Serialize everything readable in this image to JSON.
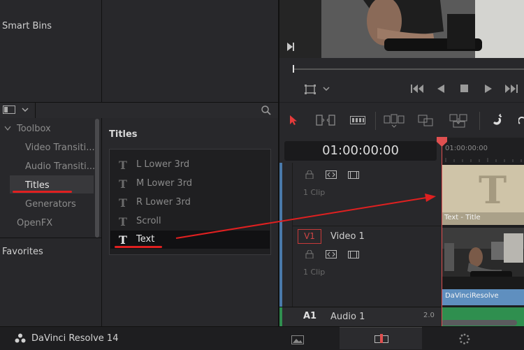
{
  "media_pool": {
    "smart_bins": "Smart Bins"
  },
  "effects_library": {
    "toolbox": "Toolbox",
    "items": [
      {
        "label": "Video Transiti..."
      },
      {
        "label": "Audio Transiti..."
      },
      {
        "label": "Titles"
      },
      {
        "label": "Generators"
      }
    ],
    "openfx": "OpenFX",
    "favorites": "Favorites"
  },
  "titles_panel": {
    "heading": "Titles",
    "items": [
      {
        "label": "L Lower 3rd"
      },
      {
        "label": "M Lower 3rd"
      },
      {
        "label": "R Lower 3rd"
      },
      {
        "label": "Scroll"
      },
      {
        "label": "Text"
      }
    ]
  },
  "timeline": {
    "timecode": "01:00:00:00",
    "ruler_label": "01:00:00:00",
    "tracks": {
      "upper_clip_count": "1 Clip",
      "v1_badge": "V1",
      "v1_name": "Video 1",
      "v1_clip_count": "1 Clip",
      "a1_badge": "A1",
      "a1_name": "Audio 1",
      "a1_level": "2.0"
    },
    "clips": {
      "title_clip": "Text - Title",
      "title_glyph": "T",
      "video_clip": "DaVinciResolve"
    }
  },
  "bottom_bar": {
    "app_name": "DaVinci Resolve 14"
  },
  "colors": {
    "accent_red": "#e02020",
    "playhead": "#e05050",
    "title_clip": "#cfc4a8",
    "video_clip": "#5f8fbf",
    "audio_track": "#2f8f4f"
  }
}
